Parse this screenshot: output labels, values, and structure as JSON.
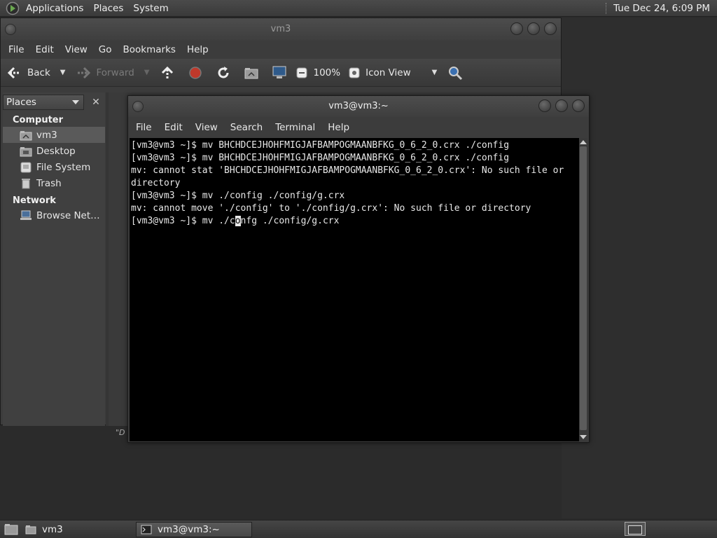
{
  "top_panel": {
    "menus": [
      "Applications",
      "Places",
      "System"
    ],
    "clock": "Tue Dec 24,  6:09 PM"
  },
  "file_manager": {
    "title": "vm3",
    "menu": [
      "File",
      "Edit",
      "View",
      "Go",
      "Bookmarks",
      "Help"
    ],
    "toolbar": {
      "back": "Back",
      "forward": "Forward",
      "zoom": "100%",
      "view_mode": "Icon View"
    },
    "sidebar": {
      "selector": "Places",
      "sections": [
        {
          "title": "Computer",
          "items": [
            {
              "label": "vm3",
              "icon": "home-folder-icon",
              "selected": true
            },
            {
              "label": "Desktop",
              "icon": "desktop-icon"
            },
            {
              "label": "File System",
              "icon": "drive-icon"
            },
            {
              "label": "Trash",
              "icon": "trash-icon"
            }
          ]
        },
        {
          "title": "Network",
          "items": [
            {
              "label": "Browse Net…",
              "icon": "network-icon"
            }
          ]
        }
      ]
    },
    "status_fragment": "\"D"
  },
  "terminal": {
    "title": "vm3@vm3:~",
    "menu": [
      "File",
      "Edit",
      "View",
      "Search",
      "Terminal",
      "Help"
    ],
    "lines": [
      "[vm3@vm3 ~]$ mv BHCHDCEJHOHFMIGJAFBAMPOGMAANBFKG_0_6_2_0.crx ./config",
      "[vm3@vm3 ~]$ mv BHCHDCEJHOHFMIGJAFBAMPOGMAANBFKG_0_6_2_0.crx ./config",
      "mv: cannot stat 'BHCHDCEJHOHFMIGJAFBAMPOGMAANBFKG_0_6_2_0.crx': No such file or",
      "directory",
      "[vm3@vm3 ~]$ mv ./config ./config/g.crx",
      "mv: cannot move './config' to './config/g.crx': No such file or directory"
    ],
    "current_line_before_cursor": "[vm3@vm3 ~]$ mv ./c",
    "cursor_char": "o",
    "current_line_after_cursor": "nfg ./config/g.crx"
  },
  "taskbar": {
    "tasks": [
      {
        "label": "vm3",
        "active": false
      },
      {
        "label": "vm3@vm3:~",
        "active": true
      }
    ]
  }
}
